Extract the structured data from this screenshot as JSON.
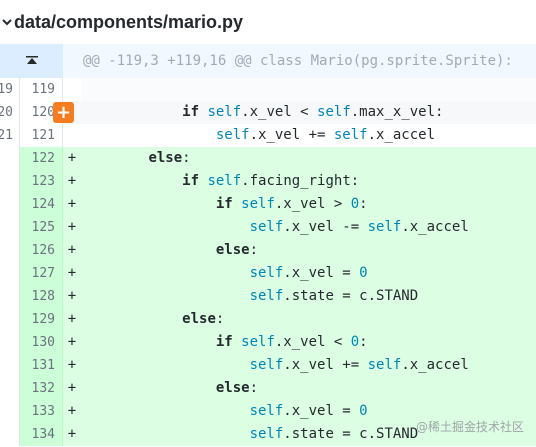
{
  "file": {
    "path": "data/components/mario.py",
    "chevron_icon": "chevron-down-icon"
  },
  "hunk": {
    "header": "@@ -119,3 +119,16 @@ class Mario(pg.sprite.Sprite):",
    "expand_icon": "expand-up-icon"
  },
  "lines": [
    {
      "old": "119",
      "new": "119",
      "marker": "",
      "type": "context",
      "indent": "",
      "tokens": []
    },
    {
      "old": "120",
      "new": "120",
      "marker": "",
      "type": "context",
      "indent": "            ",
      "tokens": [
        [
          "kw",
          "if"
        ],
        [
          "plain",
          " "
        ],
        [
          "self",
          "self"
        ],
        [
          "plain",
          ".x_vel < "
        ],
        [
          "self",
          "self"
        ],
        [
          "plain",
          ".max_x_vel:"
        ]
      ]
    },
    {
      "old": "121",
      "new": "121",
      "marker": "",
      "type": "context",
      "indent": "                ",
      "tokens": [
        [
          "self",
          "self"
        ],
        [
          "plain",
          ".x_vel += "
        ],
        [
          "self",
          "self"
        ],
        [
          "plain",
          ".x_accel"
        ]
      ]
    },
    {
      "old": "",
      "new": "122",
      "marker": "+",
      "type": "add",
      "indent": "        ",
      "tokens": [
        [
          "kw",
          "else"
        ],
        [
          "plain",
          ":"
        ]
      ]
    },
    {
      "old": "",
      "new": "123",
      "marker": "+",
      "type": "add",
      "indent": "            ",
      "tokens": [
        [
          "kw",
          "if"
        ],
        [
          "plain",
          " "
        ],
        [
          "self",
          "self"
        ],
        [
          "plain",
          ".facing_right:"
        ]
      ]
    },
    {
      "old": "",
      "new": "124",
      "marker": "+",
      "type": "add",
      "indent": "                ",
      "tokens": [
        [
          "kw",
          "if"
        ],
        [
          "plain",
          " "
        ],
        [
          "self",
          "self"
        ],
        [
          "plain",
          ".x_vel > "
        ],
        [
          "num",
          "0"
        ],
        [
          "plain",
          ":"
        ]
      ]
    },
    {
      "old": "",
      "new": "125",
      "marker": "+",
      "type": "add",
      "indent": "                    ",
      "tokens": [
        [
          "self",
          "self"
        ],
        [
          "plain",
          ".x_vel -= "
        ],
        [
          "self",
          "self"
        ],
        [
          "plain",
          ".x_accel"
        ]
      ]
    },
    {
      "old": "",
      "new": "126",
      "marker": "+",
      "type": "add",
      "indent": "                ",
      "tokens": [
        [
          "kw",
          "else"
        ],
        [
          "plain",
          ":"
        ]
      ]
    },
    {
      "old": "",
      "new": "127",
      "marker": "+",
      "type": "add",
      "indent": "                    ",
      "tokens": [
        [
          "self",
          "self"
        ],
        [
          "plain",
          ".x_vel = "
        ],
        [
          "num",
          "0"
        ]
      ]
    },
    {
      "old": "",
      "new": "128",
      "marker": "+",
      "type": "add",
      "indent": "                    ",
      "tokens": [
        [
          "self",
          "self"
        ],
        [
          "plain",
          ".state = c.STAND"
        ]
      ]
    },
    {
      "old": "",
      "new": "129",
      "marker": "+",
      "type": "add",
      "indent": "            ",
      "tokens": [
        [
          "kw",
          "else"
        ],
        [
          "plain",
          ":"
        ]
      ]
    },
    {
      "old": "",
      "new": "130",
      "marker": "+",
      "type": "add",
      "indent": "                ",
      "tokens": [
        [
          "kw",
          "if"
        ],
        [
          "plain",
          " "
        ],
        [
          "self",
          "self"
        ],
        [
          "plain",
          ".x_vel < "
        ],
        [
          "num",
          "0"
        ],
        [
          "plain",
          ":"
        ]
      ]
    },
    {
      "old": "",
      "new": "131",
      "marker": "+",
      "type": "add",
      "indent": "                    ",
      "tokens": [
        [
          "self",
          "self"
        ],
        [
          "plain",
          ".x_vel += "
        ],
        [
          "self",
          "self"
        ],
        [
          "plain",
          ".x_accel"
        ]
      ]
    },
    {
      "old": "",
      "new": "132",
      "marker": "+",
      "type": "add",
      "indent": "                ",
      "tokens": [
        [
          "kw",
          "else"
        ],
        [
          "plain",
          ":"
        ]
      ]
    },
    {
      "old": "",
      "new": "133",
      "marker": "+",
      "type": "add",
      "indent": "                    ",
      "tokens": [
        [
          "self",
          "self"
        ],
        [
          "plain",
          ".x_vel = "
        ],
        [
          "num",
          "0"
        ]
      ]
    },
    {
      "old": "",
      "new": "134",
      "marker": "+",
      "type": "add",
      "indent": "                    ",
      "tokens": [
        [
          "self",
          "self"
        ],
        [
          "plain",
          ".state = c.STAND"
        ]
      ]
    }
  ],
  "add_comment_button": {
    "label": "+",
    "line": "120"
  },
  "watermark": "@稀土掘金技术社区"
}
